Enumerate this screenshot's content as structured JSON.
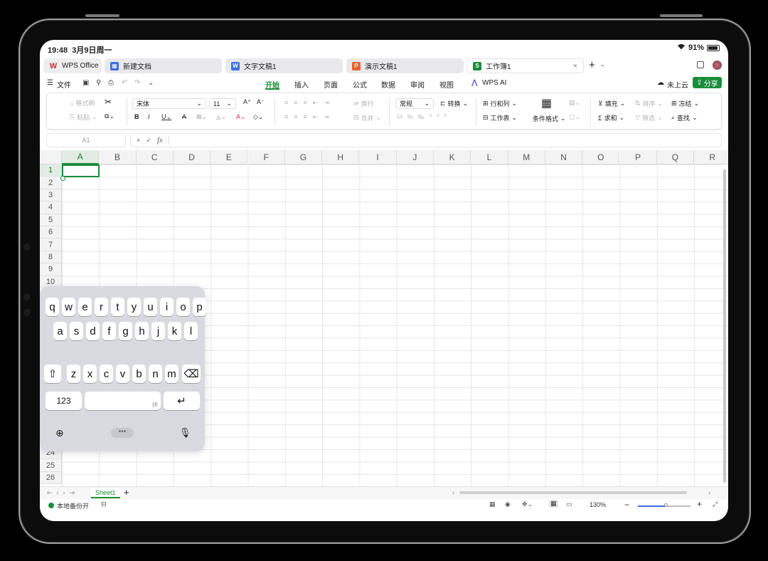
{
  "status": {
    "time": "19:48",
    "date": "3月9日周一",
    "battery": "91%"
  },
  "tabs": [
    {
      "label": "WPS Office",
      "icon": "wps-logo-icon",
      "color": "#d7282e"
    },
    {
      "label": "新建文档",
      "icon": "new-doc-icon",
      "color": "#3d6fe0"
    },
    {
      "label": "文字文稿1",
      "icon": "W",
      "color": "#3d6fe0"
    },
    {
      "label": "演示文稿1",
      "icon": "P",
      "color": "#e8622c"
    },
    {
      "label": "工作簿1",
      "icon": "S",
      "color": "#1a8d3b"
    }
  ],
  "menu": {
    "file": "文件",
    "items": [
      "开始",
      "插入",
      "页面",
      "公式",
      "数据",
      "审阅",
      "视图"
    ],
    "wps_ai": "WPS AI",
    "cloud": "未上云",
    "share": "分享"
  },
  "ribbon": {
    "format_painter": "格式刷",
    "paste": "粘贴",
    "font": "宋体",
    "size": "11",
    "wrap": "换行",
    "merge": "合并",
    "number_format": "常规",
    "convert": "转换",
    "row_col": "行和列",
    "worksheet": "工作表",
    "cond_format": "条件格式",
    "fill": "填充",
    "sort": "排序",
    "freeze": "冻结",
    "sum": "求和",
    "filter": "筛选",
    "find": "查找"
  },
  "formula": {
    "cell_ref": "A1",
    "fx": "fx"
  },
  "columns": [
    "A",
    "B",
    "C",
    "D",
    "E",
    "F",
    "G",
    "H",
    "I",
    "J",
    "K",
    "L",
    "M",
    "N",
    "O",
    "P",
    "Q",
    "R"
  ],
  "rows": [
    "1",
    "2",
    "3",
    "4",
    "5",
    "6",
    "7",
    "8",
    "9",
    "10",
    "24",
    "25",
    "26"
  ],
  "keyboard": {
    "row1": [
      "q",
      "w",
      "e",
      "r",
      "t",
      "y",
      "u",
      "i",
      "o",
      "p"
    ],
    "row2": [
      "a",
      "s",
      "d",
      "f",
      "g",
      "h",
      "j",
      "k",
      "l"
    ],
    "row3": [
      "z",
      "x",
      "c",
      "v",
      "b",
      "n",
      "m"
    ],
    "numbers": "123",
    "space_hint": "拼"
  },
  "sheet": {
    "name": "Sheet1"
  },
  "statusbar": {
    "backup": "本地备份开",
    "zoom": "130%"
  }
}
